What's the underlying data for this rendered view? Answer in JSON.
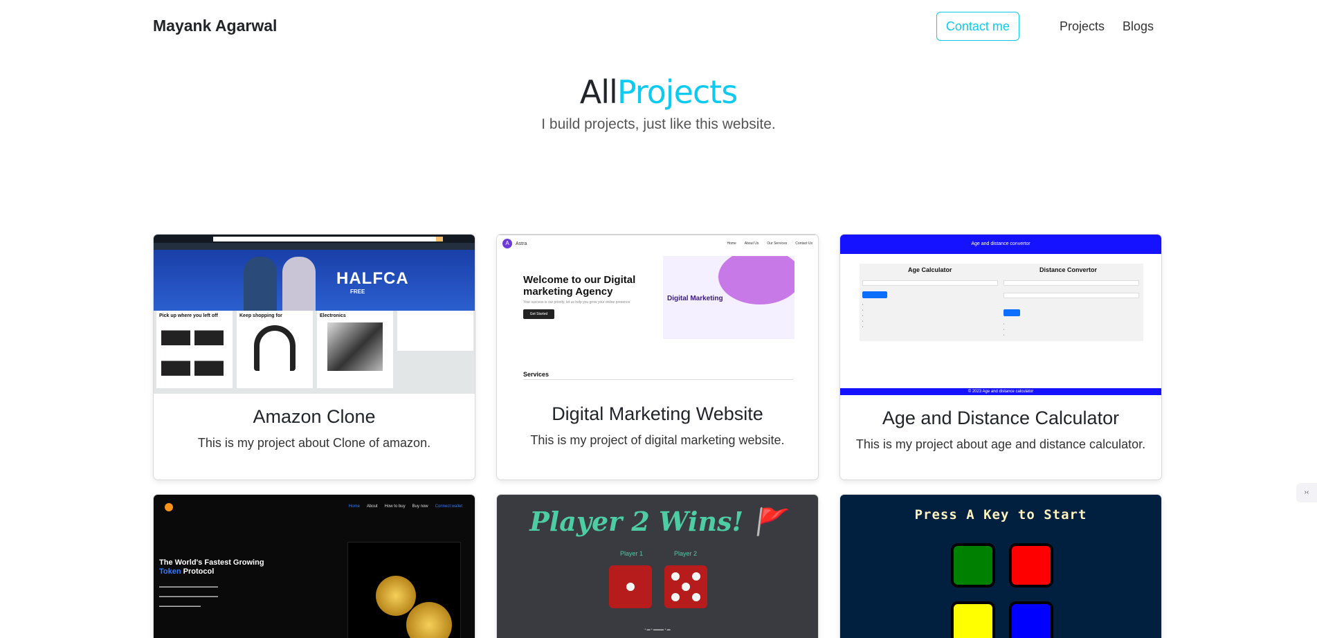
{
  "nav": {
    "brand": "Mayank Agarwal",
    "contact": "Contact me",
    "links": [
      "Projects",
      "Blogs"
    ]
  },
  "hero": {
    "title_prefix": "All",
    "title_accent": "Projects",
    "subtitle": "I build projects, just like this website."
  },
  "projects": [
    {
      "title": "Amazon Clone",
      "text": "This is my project about Clone of amazon."
    },
    {
      "title": "Digital Marketing Website",
      "text": "This is my project of digital marketing website."
    },
    {
      "title": "Age and Distance Calculator",
      "text": "This is my project about age and distance calculator."
    }
  ],
  "thumbs": {
    "amazon": {
      "banner": "HALFCA",
      "free": "FREE",
      "box1": "Pick up where you left off",
      "box2": "Keep shopping for",
      "box3": "Electronics"
    },
    "dm": {
      "logo": "Astra",
      "links": [
        "Home",
        "About Us",
        "Our Services",
        "Contact Us"
      ],
      "heading": "Welcome to our Digital marketing Agency",
      "sub": "Your success is our priority, let us help you grow your online presence",
      "btn": "Get Started",
      "img_text": "Digital Marketing",
      "services": "Services"
    },
    "age": {
      "header": "Age and distance convertor",
      "left": "Age Calculator",
      "right": "Distance Convertor",
      "footer": "© 2023 Age and distance calculator"
    },
    "crypto": {
      "links": [
        "Home",
        "About",
        "How to buy",
        "Buy now",
        "Connect wallet"
      ],
      "heading": "The World's Fastest Growing",
      "heading_accent": "Token",
      "heading_end": "Protocol"
    },
    "dice": {
      "title": "Player 2 Wins!",
      "flag": "🚩",
      "p1": "Player 1",
      "p2": "Player 2"
    },
    "simon": {
      "title": "Press A Key to Start"
    }
  },
  "colors": {
    "accent": "#0dcaf0",
    "age_header": "#1412ff",
    "simon_bg": "#011f3f",
    "dice_bg": "#393b41"
  }
}
